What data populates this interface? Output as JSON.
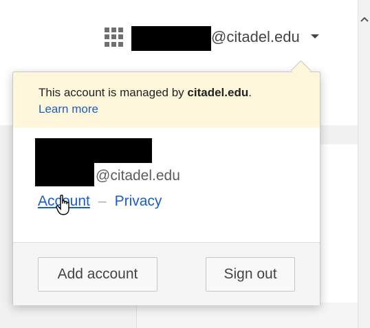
{
  "header": {
    "account_email_domain": "@citadel.edu",
    "apps_icon": "grid-icon"
  },
  "popup": {
    "notice_prefix": "This account is managed by ",
    "notice_domain": "citadel.edu",
    "notice_suffix": ".",
    "learn_more": "Learn more",
    "user_email_domain": "@citadel.edu",
    "account_link": "Account",
    "separator": "–",
    "privacy_link": "Privacy",
    "add_account_label": "Add account",
    "sign_out_label": "Sign out"
  },
  "colors": {
    "notice_bg": "#fef7dc",
    "link": "#1a5dc9"
  }
}
